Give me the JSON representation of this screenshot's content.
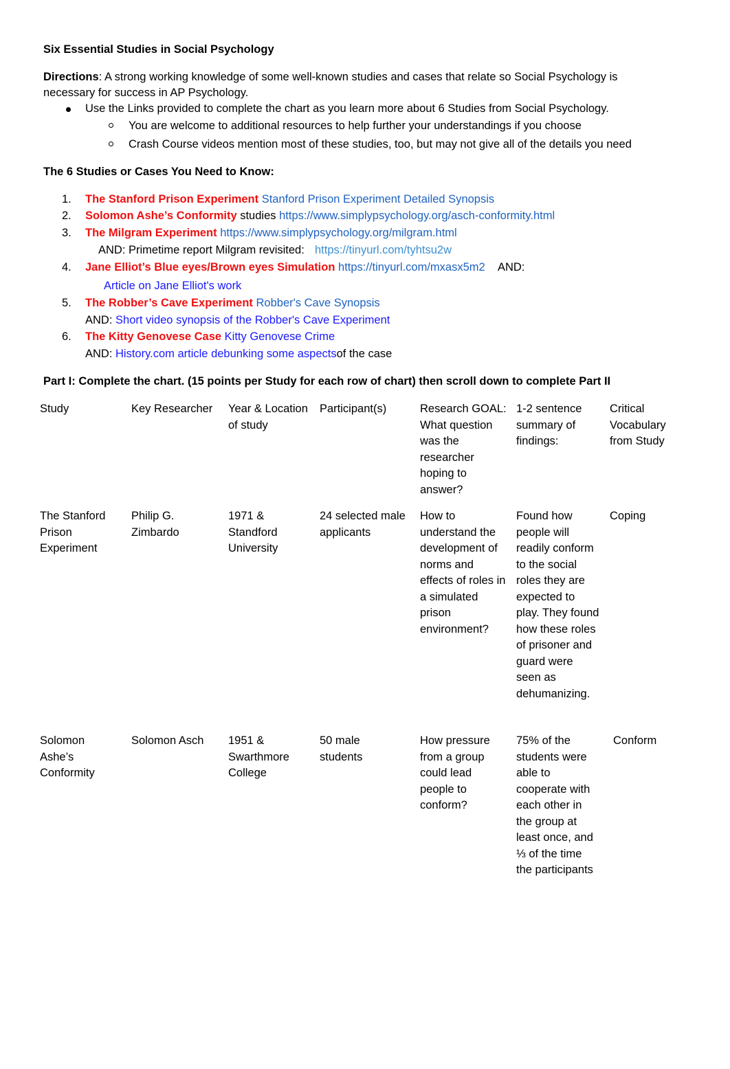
{
  "title": "Six Essential Studies in Social Psychology",
  "directions": {
    "label": "Directions",
    "text_line1": ": A strong working knowledge of some well-known studies and cases that relate so Social Psychology is",
    "text_line2": "necessary for success in AP Psychology.",
    "bullet": "Use the Links provided to complete the chart as you learn more about 6 Studies from Social Psychology.",
    "sub_bullets": [
      "You are welcome to additional resources to help further your understandings if you choose",
      "Crash Course videos mention most of these studies, too, but may not give all of the details you need"
    ]
  },
  "studies_heading": "The 6 Studies or Cases You Need to Know:",
  "studies": [
    {
      "number": "1.",
      "name": "The Stanford Prison Experiment",
      "link": "Stanford Prison Experiment Detailed Synopsis"
    },
    {
      "number": "2.",
      "name": "Solomon Ashe’s Conformity",
      "middle_text": "studies",
      "link": "https://www.simplypsychology.org/asch-conformity.html"
    },
    {
      "number": "3.",
      "name": "The Milgram Experiment",
      "link": "https://www.simplypsychology.org/milgram.html",
      "extra_prefix": "AND: Primetime report Milgram revisited:",
      "extra_link": "https://tinyurl.com/tyhtsu2w"
    },
    {
      "number": "4.",
      "name": "Jane Elliot’s Blue eyes/Brown eyes Simulation",
      "link": "https://tinyurl.com/mxasx5m2",
      "trailing": "AND:",
      "extra_link": "Article on Jane Elliot's work"
    },
    {
      "number": "5.",
      "name": "The Robber’s Cave Experiment",
      "link": "Robber's Cave Synopsis",
      "extra_prefix": "AND:",
      "extra_link": "Short video synopsis of the Robber's Cave Experiment"
    },
    {
      "number": "6.",
      "name": "The Kitty Genovese Case",
      "link": "Kitty Genovese Crime",
      "extra_prefix": "AND:",
      "extra_link": "History.com article debunking some aspects",
      "extra_suffix": "of the case"
    }
  ],
  "part1_heading": "Part I: Complete the chart. (15 points per Study for each row of chart) then scroll down to complete Part II",
  "table": {
    "headers": [
      "Study",
      "Key Researcher",
      "Year & Location of study",
      "Participant(s)",
      "Research GOAL: What question was the researcher hoping to answer?",
      "1-2 sentence summary of findings:",
      "Critical Vocabulary from Study"
    ],
    "rows": [
      [
        "The Stanford Prison Experiment",
        "Philip G. Zimbardo",
        "1971 & Standford University",
        "24 selected male applicants",
        "How to understand the development of norms and effects of roles in a simulated prison environment?",
        "Found how people will readily conform to the social roles they are expected to play. They found how these roles of prisoner and guard were seen as dehumanizing.",
        "Coping"
      ],
      [
        "Solomon Ashe’s Conformity",
        "Solomon Asch",
        "1951 & Swarthmore College",
        "50 male students",
        "How pressure from a group could lead people to conform?",
        "75% of the students were able to cooperate with each other in the group at least once, and ⅓ of the time the participants",
        "Conform"
      ]
    ]
  },
  "colors": {
    "study_name": "#ee1111",
    "link_mid": "#1f62c0",
    "link_light": "#3b8fd2",
    "link_pure": "#1a1aff"
  }
}
